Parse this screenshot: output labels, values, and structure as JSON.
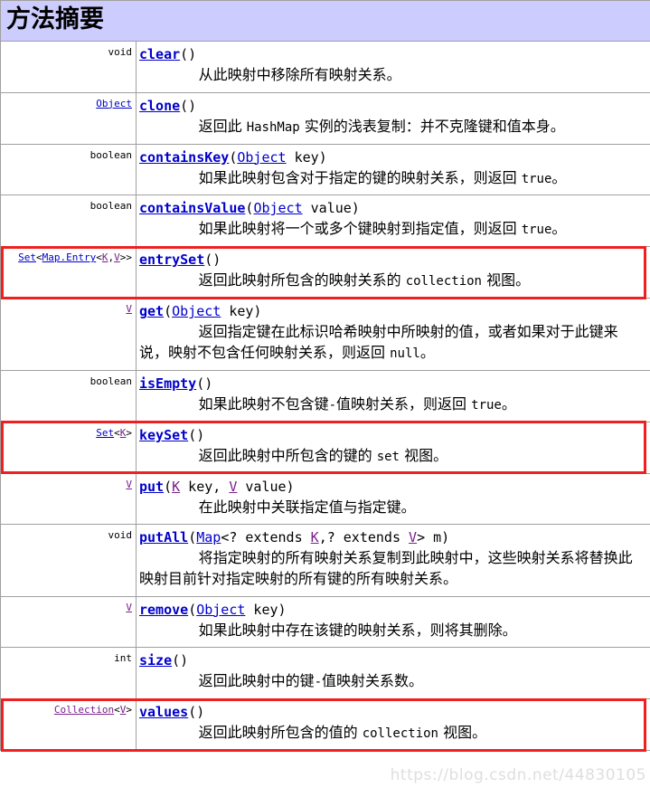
{
  "header": {
    "title": "方法摘要"
  },
  "colors": {
    "header_bg": "#ccccff",
    "link": "#0000cc",
    "visited_link": "#7a1f8c",
    "highlight_box": "#f02020",
    "border": "#a0a0a0"
  },
  "watermark": {
    "text": "https://blog.csdn.net/44830105"
  },
  "methods": [
    {
      "return_type": "void",
      "return_parts": [
        {
          "text": "void",
          "kind": "plain"
        }
      ],
      "name": "clear",
      "signature_params": [
        {
          "text": "()",
          "kind": "plain"
        }
      ],
      "description": "从此映射中移除所有映射关系。",
      "highlighted": false
    },
    {
      "return_type": "Object",
      "return_parts": [
        {
          "text": "Object",
          "kind": "link"
        }
      ],
      "name": "clone",
      "signature_params": [
        {
          "text": "()",
          "kind": "plain"
        }
      ],
      "description": "返回此 HashMap 实例的浅表复制：并不克隆键和值本身。",
      "highlighted": false
    },
    {
      "return_type": "boolean",
      "return_parts": [
        {
          "text": "boolean",
          "kind": "plain"
        }
      ],
      "name": "containsKey",
      "signature_params": [
        {
          "text": "(",
          "kind": "plain"
        },
        {
          "text": "Object",
          "kind": "link"
        },
        {
          "text": " key)",
          "kind": "plain"
        }
      ],
      "description": "如果此映射包含对于指定的键的映射关系，则返回 true。",
      "highlighted": false
    },
    {
      "return_type": "boolean",
      "return_parts": [
        {
          "text": "boolean",
          "kind": "plain"
        }
      ],
      "name": "containsValue",
      "signature_params": [
        {
          "text": "(",
          "kind": "plain"
        },
        {
          "text": "Object",
          "kind": "link"
        },
        {
          "text": " value)",
          "kind": "plain"
        }
      ],
      "description": "如果此映射将一个或多个键映射到指定值，则返回 true。",
      "highlighted": false
    },
    {
      "return_type": "Set<Map.Entry<K,V>>",
      "return_parts": [
        {
          "text": "Set",
          "kind": "link"
        },
        {
          "text": "<",
          "kind": "plain"
        },
        {
          "text": "Map.Entry",
          "kind": "link"
        },
        {
          "text": "<",
          "kind": "plain"
        },
        {
          "text": "K",
          "kind": "visited"
        },
        {
          "text": ",",
          "kind": "plain"
        },
        {
          "text": "V",
          "kind": "visited"
        },
        {
          "text": ">>",
          "kind": "plain"
        }
      ],
      "name": "entrySet",
      "signature_params": [
        {
          "text": "()",
          "kind": "plain"
        }
      ],
      "description": "返回此映射所包含的映射关系的 collection 视图。",
      "highlighted": true
    },
    {
      "return_type": "V",
      "return_parts": [
        {
          "text": "V",
          "kind": "visited"
        }
      ],
      "name": "get",
      "signature_params": [
        {
          "text": "(",
          "kind": "plain"
        },
        {
          "text": "Object",
          "kind": "link"
        },
        {
          "text": " key)",
          "kind": "plain"
        }
      ],
      "description": "返回指定键在此标识哈希映射中所映射的值，或者如果对于此键来说，映射不包含任何映射关系，则返回 null。",
      "highlighted": false
    },
    {
      "return_type": "boolean",
      "return_parts": [
        {
          "text": "boolean",
          "kind": "plain"
        }
      ],
      "name": "isEmpty",
      "signature_params": [
        {
          "text": "()",
          "kind": "plain"
        }
      ],
      "description": "如果此映射不包含键-值映射关系，则返回 true。",
      "highlighted": false
    },
    {
      "return_type": "Set<K>",
      "return_parts": [
        {
          "text": "Set",
          "kind": "link"
        },
        {
          "text": "<",
          "kind": "plain"
        },
        {
          "text": "K",
          "kind": "visited"
        },
        {
          "text": ">",
          "kind": "plain"
        }
      ],
      "name": "keySet",
      "signature_params": [
        {
          "text": "()",
          "kind": "plain"
        }
      ],
      "description": "返回此映射中所包含的键的 set 视图。",
      "highlighted": true
    },
    {
      "return_type": "V",
      "return_parts": [
        {
          "text": "V",
          "kind": "visited"
        }
      ],
      "name": "put",
      "signature_params": [
        {
          "text": "(",
          "kind": "plain"
        },
        {
          "text": "K",
          "kind": "visited"
        },
        {
          "text": " key, ",
          "kind": "plain"
        },
        {
          "text": "V",
          "kind": "visited"
        },
        {
          "text": " value)",
          "kind": "plain"
        }
      ],
      "description": "在此映射中关联指定值与指定键。",
      "highlighted": false
    },
    {
      "return_type": "void",
      "return_parts": [
        {
          "text": "void",
          "kind": "plain"
        }
      ],
      "name": "putAll",
      "signature_params": [
        {
          "text": "(",
          "kind": "plain"
        },
        {
          "text": "Map",
          "kind": "link"
        },
        {
          "text": "<? extends ",
          "kind": "plain"
        },
        {
          "text": "K",
          "kind": "visited"
        },
        {
          "text": ",? extends ",
          "kind": "plain"
        },
        {
          "text": "V",
          "kind": "visited"
        },
        {
          "text": "> m)",
          "kind": "plain"
        }
      ],
      "description": "将指定映射的所有映射关系复制到此映射中，这些映射关系将替换此映射目前针对指定映射的所有键的所有映射关系。",
      "highlighted": false
    },
    {
      "return_type": "V",
      "return_parts": [
        {
          "text": "V",
          "kind": "visited"
        }
      ],
      "name": "remove",
      "signature_params": [
        {
          "text": "(",
          "kind": "plain"
        },
        {
          "text": "Object",
          "kind": "link"
        },
        {
          "text": " key)",
          "kind": "plain"
        }
      ],
      "description": "如果此映射中存在该键的映射关系，则将其删除。",
      "highlighted": false
    },
    {
      "return_type": "int",
      "return_parts": [
        {
          "text": "int",
          "kind": "plain"
        }
      ],
      "name": "size",
      "signature_params": [
        {
          "text": "()",
          "kind": "plain"
        }
      ],
      "description": "返回此映射中的键-值映射关系数。",
      "highlighted": false
    },
    {
      "return_type": "Collection<V>",
      "return_parts": [
        {
          "text": "Collection",
          "kind": "visited"
        },
        {
          "text": "<",
          "kind": "plain"
        },
        {
          "text": "V",
          "kind": "visited"
        },
        {
          "text": ">",
          "kind": "plain"
        }
      ],
      "name": "values",
      "signature_params": [
        {
          "text": "()",
          "kind": "plain"
        }
      ],
      "description": "返回此映射所包含的值的 collection 视图。",
      "highlighted": true
    }
  ]
}
